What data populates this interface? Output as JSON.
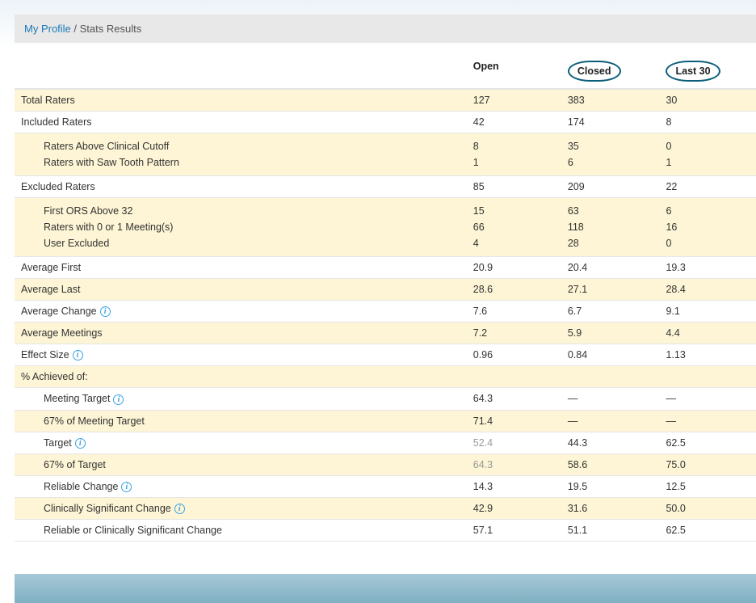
{
  "breadcrumb": {
    "link": "My Profile",
    "sep": " / ",
    "current": "Stats Results"
  },
  "columns": {
    "open": "Open",
    "closed": "Closed",
    "last30": "Last 30"
  },
  "rows": {
    "total_raters": {
      "label": "Total Raters",
      "open": "127",
      "closed": "383",
      "last30": "30"
    },
    "included_raters": {
      "label": "Included Raters",
      "open": "42",
      "closed": "174",
      "last30": "8"
    },
    "included_sub": {
      "labels": [
        "Raters Above Clinical Cutoff",
        "Raters with Saw Tooth Pattern"
      ],
      "open": [
        "8",
        "1"
      ],
      "closed": [
        "35",
        "6"
      ],
      "last30": [
        "0",
        "1"
      ]
    },
    "excluded_raters": {
      "label": "Excluded Raters",
      "open": "85",
      "closed": "209",
      "last30": "22"
    },
    "excluded_sub": {
      "labels": [
        "First ORS Above 32",
        "Raters with 0 or 1 Meeting(s)",
        "User Excluded"
      ],
      "open": [
        "15",
        "66",
        "4"
      ],
      "closed": [
        "63",
        "118",
        "28"
      ],
      "last30": [
        "6",
        "16",
        "0"
      ]
    },
    "avg_first": {
      "label": "Average First",
      "open": "20.9",
      "closed": "20.4",
      "last30": "19.3"
    },
    "avg_last": {
      "label": "Average Last",
      "open": "28.6",
      "closed": "27.1",
      "last30": "28.4"
    },
    "avg_change": {
      "label": "Average Change",
      "open": "7.6",
      "closed": "6.7",
      "last30": "9.1"
    },
    "avg_meetings": {
      "label": "Average Meetings",
      "open": "7.2",
      "closed": "5.9",
      "last30": "4.4"
    },
    "effect_size": {
      "label": "Effect Size",
      "open": "0.96",
      "closed": "0.84",
      "last30": "1.13"
    },
    "pct_achieved": {
      "label": "% Achieved of:"
    },
    "meeting_target": {
      "label": "Meeting Target",
      "open": "64.3",
      "closed": "—",
      "last30": "—"
    },
    "pct67_meeting_target": {
      "label": "67% of Meeting Target",
      "open": "71.4",
      "closed": "—",
      "last30": "—"
    },
    "target": {
      "label": "Target",
      "open": "52.4",
      "closed": "44.3",
      "last30": "62.5"
    },
    "pct67_target": {
      "label": "67% of Target",
      "open": "64.3",
      "closed": "58.6",
      "last30": "75.0"
    },
    "reliable_change": {
      "label": "Reliable Change",
      "open": "14.3",
      "closed": "19.5",
      "last30": "12.5"
    },
    "clin_sig_change": {
      "label": "Clinically Significant Change",
      "open": "42.9",
      "closed": "31.6",
      "last30": "50.0"
    },
    "rel_or_clin": {
      "label": "Reliable or Clinically Significant Change",
      "open": "57.1",
      "closed": "51.1",
      "last30": "62.5"
    }
  }
}
